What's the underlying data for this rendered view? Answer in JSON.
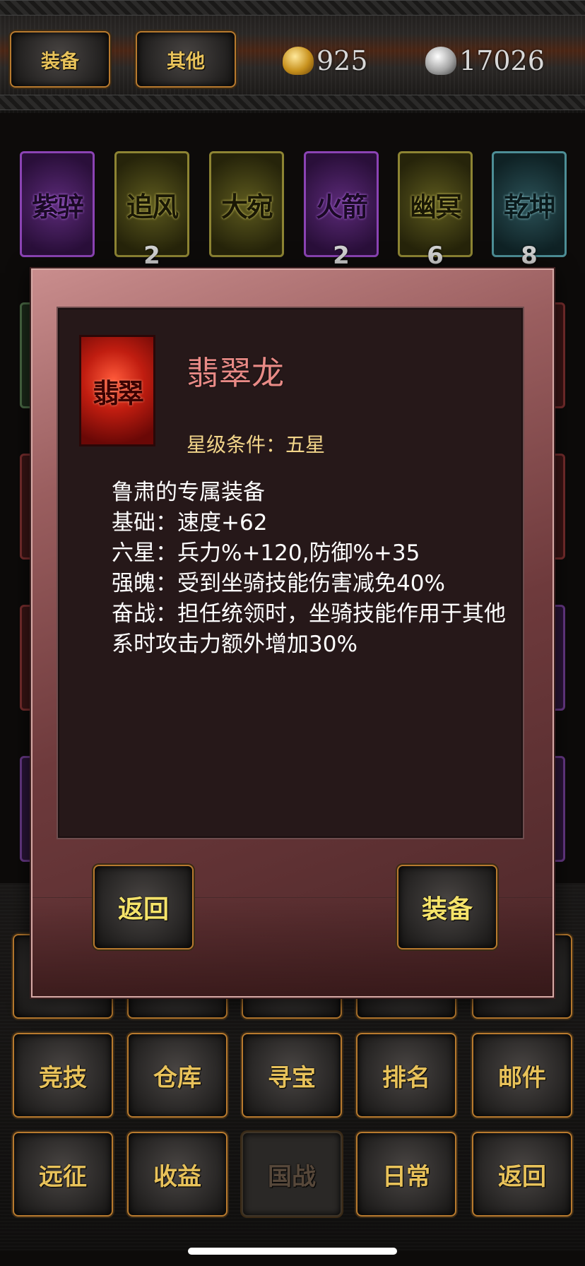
{
  "top": {
    "tabs": [
      "装备",
      "其他"
    ],
    "gold": "925",
    "silver": "17026"
  },
  "mounts": [
    {
      "name": "紫骍",
      "count": "",
      "color": "purple"
    },
    {
      "name": "追风",
      "count": "2",
      "color": "yellow"
    },
    {
      "name": "大宛",
      "count": "",
      "color": "yellow"
    },
    {
      "name": "火箭",
      "count": "2",
      "color": "purple"
    },
    {
      "name": "幽冥",
      "count": "6",
      "color": "yellow"
    },
    {
      "name": "乾坤",
      "count": "8",
      "color": "teal"
    }
  ],
  "grid": [
    [
      "竞技",
      "仓库",
      "寻宝",
      "排名",
      "邮件"
    ],
    [
      "远征",
      "收益",
      "国战",
      "日常",
      "返回"
    ]
  ],
  "modal": {
    "icon_text": "翡翠",
    "name": "翡翠龙",
    "star_condition": "星级条件：五星",
    "lines": [
      "鲁肃的专属装备",
      "基础：速度+62",
      "六星：兵力%+120,防御%+35",
      "强魄：受到坐骑技能伤害减免40%",
      "奋战：担任统领时，坐骑技能作用于其他系时攻击力额外增加30%"
    ],
    "back_label": "返回",
    "equip_label": "装备"
  }
}
